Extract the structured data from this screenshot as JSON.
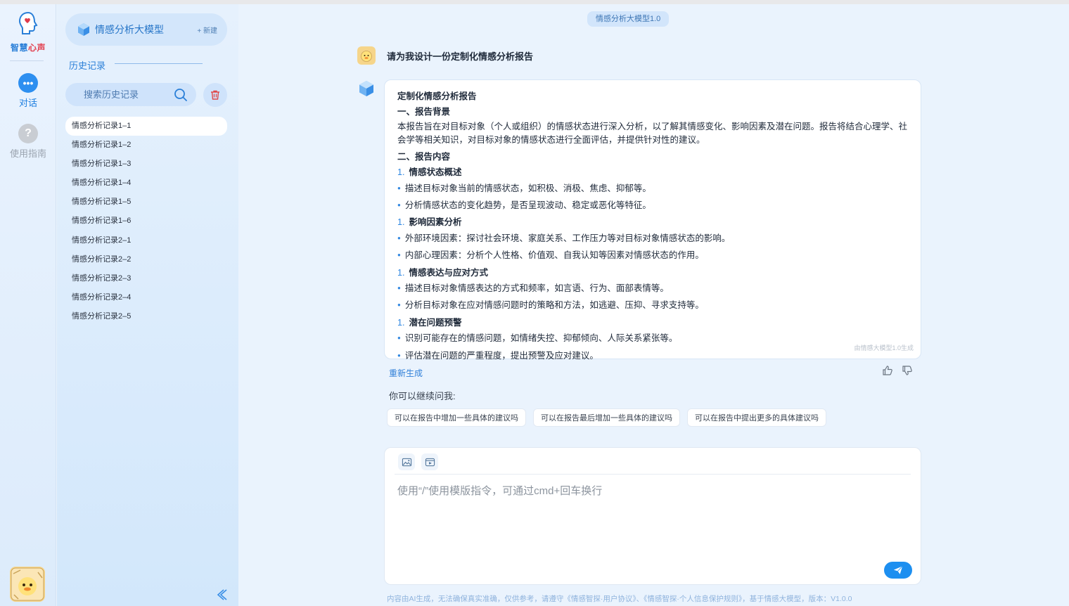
{
  "rail": {
    "brand_a": "智慧",
    "brand_b": "心声",
    "chat_label": "对话",
    "guide_label": "使用指南",
    "guide_glyph": "?",
    "chat_glyph": "•••"
  },
  "sidebar": {
    "model_name": "情感分析大模型",
    "new_label": "+ 新建",
    "history_label": "历史记录",
    "search_placeholder": "搜索历史记录",
    "items": [
      "情感分析记录1–1",
      "情感分析记录1–2",
      "情感分析记录1–3",
      "情感分析记录1–4",
      "情感分析记录1–5",
      "情感分析记录1–6",
      "情感分析记录2–1",
      "情感分析记录2–2",
      "情感分析记录2–3",
      "情感分析记录2–4",
      "情感分析记录2–5"
    ]
  },
  "main": {
    "model_badge": "情感分析大模型1.0",
    "user_message": "请为我设计一份定制化情感分析报告",
    "answer": {
      "title": "定制化情感分析报告",
      "s1": "一、报告背景",
      "p1": "本报告旨在对目标对象（个人或组织）的情感状态进行深入分析，以了解其情感变化、影响因素及潜在问题。报告将结合心理学、社会学等相关知识，对目标对象的情感状态进行全面评估，并提供针对性的建议。",
      "s2": "二、报告内容",
      "n": "1.",
      "sub1": "情感状态概述",
      "b1": "描述目标对象当前的情感状态，如积极、消极、焦虑、抑郁等。",
      "b2": "分析情感状态的变化趋势，是否呈现波动、稳定或恶化等特征。",
      "sub2": "影响因素分析",
      "b3": "外部环境因素：探讨社会环境、家庭关系、工作压力等对目标对象情感状态的影响。",
      "b4": "内部心理因素：分析个人性格、价值观、自我认知等因素对情感状态的作用。",
      "sub3": "情感表达与应对方式",
      "b5": "描述目标对象情感表达的方式和频率，如言语、行为、面部表情等。",
      "b6": "分析目标对象在应对情感问题时的策略和方法，如逃避、压抑、寻求支持等。",
      "sub4": "潜在问题预警",
      "b7": "识别可能存在的情感问题，如情绪失控、抑郁倾向、人际关系紧张等。",
      "b8": "评估潜在问题的严重程度，提出预警及应对建议。",
      "footnote": "由情感大模型1.0生成"
    },
    "regenerate": "重新生成",
    "continue_label": "你可以继续问我:",
    "suggestions": [
      "可以在报告中增加一些具体的建议吗",
      "可以在报告最后增加一些具体的建议吗",
      "可以在报告中提出更多的具体建议吗"
    ],
    "input_placeholder": "使用“/”使用模版指令，可通过cmd+回车换行",
    "disclaimer": "内容由AI生成，无法确保真实准确，仅供参考，请遵守《情感智探·用户协议》、《情感智探·个人信息保护规则》，基于情感大模型，版本：V1.0.0"
  },
  "colors": {
    "accent": "#2f86e0",
    "brand_red": "#e23b4b",
    "send": "#1d8ff0"
  }
}
